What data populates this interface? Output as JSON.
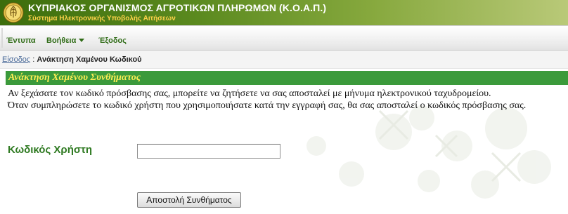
{
  "header": {
    "title": "ΚΥΠΡΙΑΚΟΣ ΟΡΓΑΝΙΣΜΟΣ ΑΓΡΟΤΙΚΩΝ ΠΛΗΡΩΜΩΝ (Κ.Ο.Α.Π.)",
    "subtitle": "Σύστημα Ηλεκτρονικής Υποβολής Αιτήσεων",
    "logo_icon": "agency-seal-icon",
    "colors": {
      "banner_dark": "#3c6d0c",
      "banner_light": "#b9c978",
      "title": "#ffffff",
      "subtitle": "#ffd24a"
    }
  },
  "menu": {
    "items": [
      {
        "label": "Έντυπα"
      },
      {
        "label": "Βοήθεια",
        "icon": "chevron-down-icon"
      },
      {
        "label": "Έξοδος"
      }
    ],
    "text_color": "#2f6b16"
  },
  "breadcrumb": {
    "link_label": "Είσοδος",
    "separator": " : ",
    "current": "Ανάκτηση Χαμένου Κωδικού"
  },
  "section": {
    "title": "Ανάκτηση Χαμένου Συνθήματος",
    "bar_color": "#3b9a3b",
    "title_color": "#ffee55",
    "intro_line1": "Αν ξεχάσατε τον κωδικό πρόσβασης σας, μπορείτε να ζητήσετε να σας αποσταλεί με μήνυμα ηλεκτρονικού ταχυδρομείου.",
    "intro_line2": "Όταν συμπληρώσετε το κωδικό χρήστη που χρησιμοποιήσατε κατά την εγγραφή σας, θα σας αποσταλεί ο κωδικός πρόσβασης σας."
  },
  "form": {
    "username_label": "Κωδικός Χρήστη",
    "username_value": "",
    "username_placeholder": "",
    "submit_label": "Αποστολή Συνθήματος"
  }
}
